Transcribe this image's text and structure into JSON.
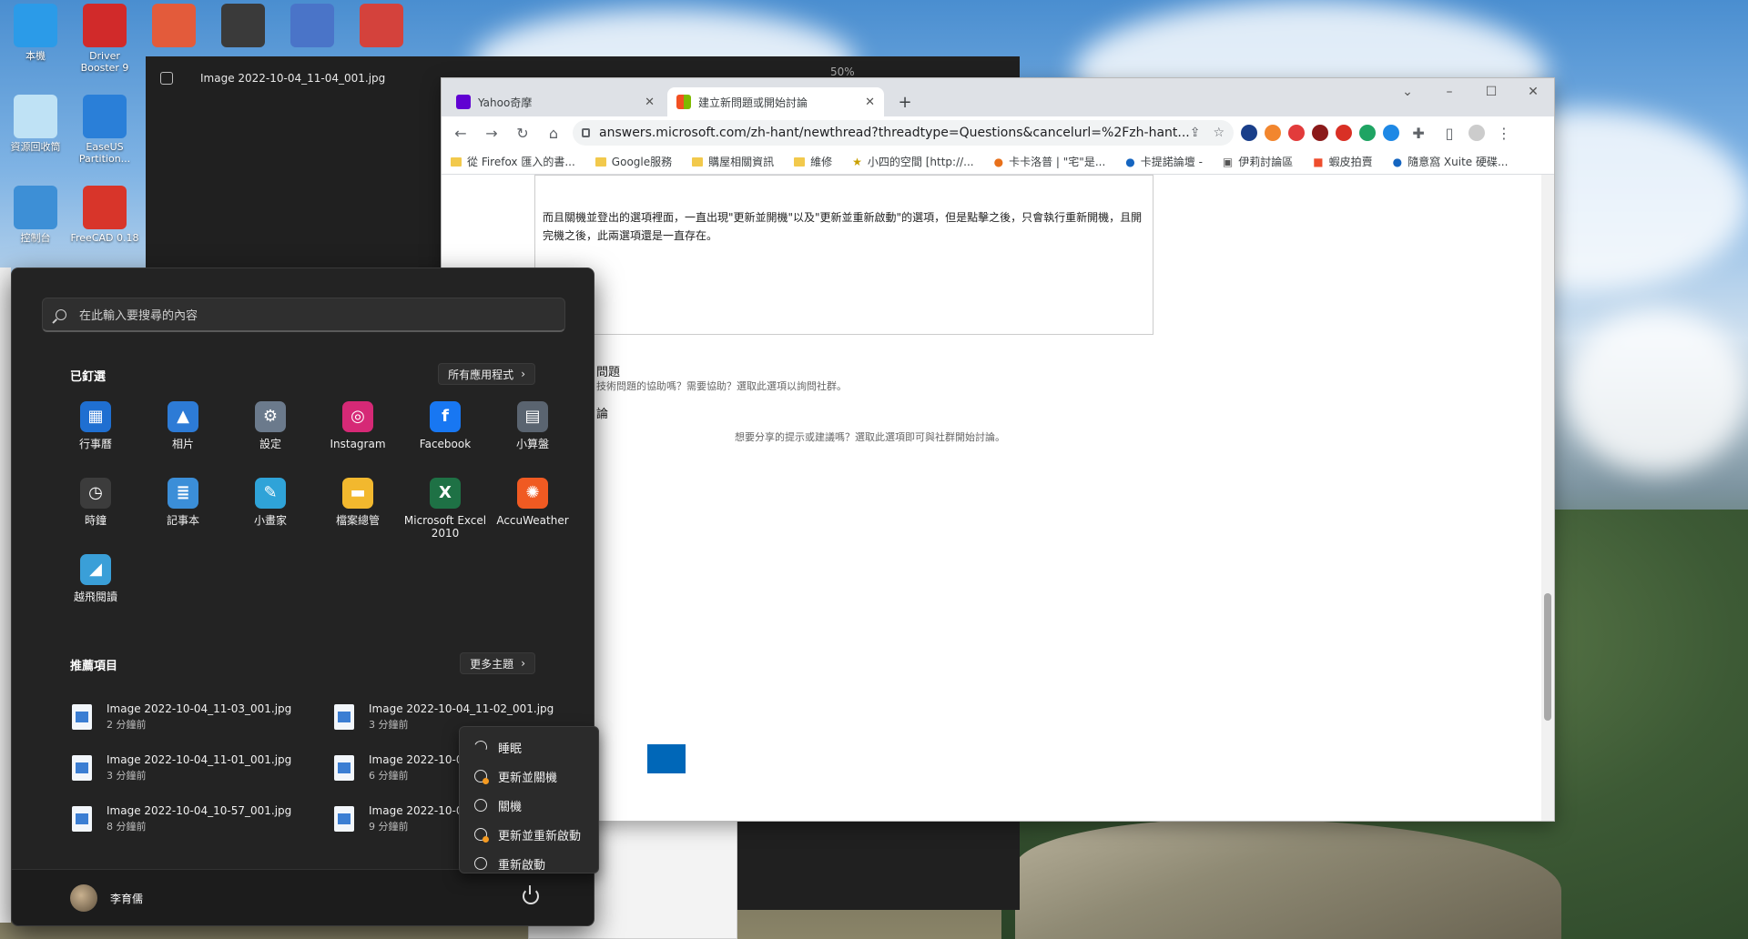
{
  "desktop": {
    "icons": [
      {
        "label": "本機",
        "color": "#2b9be8"
      },
      {
        "label": "Driver Booster 9",
        "color": "#d12a2a"
      },
      {
        "label": "",
        "color": "#e35b3b"
      },
      {
        "label": "",
        "color": "#3a3a3a"
      },
      {
        "label": "",
        "color": "#4a74c8"
      },
      {
        "label": "",
        "color": "#d4423c"
      },
      {
        "label": "資源回收筒",
        "color": "#bfe2f5"
      },
      {
        "label": "EaseUS Partition...",
        "color": "#2a7fd8"
      },
      {
        "label": "控制台",
        "color": "#3d8fd6"
      },
      {
        "label": "FreeCAD 0.18",
        "color": "#d8352a"
      }
    ]
  },
  "viewer": {
    "title": "Image 2022-10-04_11-04_001.jpg",
    "zoom": "50%"
  },
  "chrome": {
    "tabs": [
      {
        "title": "Yahoo奇摩",
        "favicon_color": "#6001d2"
      },
      {
        "title": "建立新問題或開始討論",
        "favicon_color": "#f25022"
      }
    ],
    "new_tab": "+",
    "url": "answers.microsoft.com/zh-hant/newthread?threadtype=Questions&cancelurl=%2Fzh-hant...",
    "bookmarks": [
      "從 Firefox 匯入的書...",
      "Google服務",
      "購屋相關資訊",
      "維修",
      "小四的空間 [http://...",
      "卡卡洛普 | \"宅\"是...",
      "卡提諾論壇 -",
      "伊莉討論區",
      "蝦皮拍賣",
      "隨意窩 Xuite 硬碟..."
    ],
    "body_text": "而且關機並登出的選項裡面，一直出現\"更新並開機\"以及\"更新並重新啟動\"的選項，但是點擊之後，只會執行重新開機，且開完機之後，此兩選項還是一直存在。",
    "option1_title": "問題",
    "option1_desc": "技術問題的協助嗎？需要協助？選取此選項以詢問社群。",
    "option2_title": "論",
    "option2_desc": "想要分享的提示或建議嗎？選取此選項即可與社群開始討論。"
  },
  "start_menu": {
    "search_placeholder": "在此輸入要搜尋的內容",
    "pinned_title": "已釘選",
    "all_apps_label": "所有應用程式",
    "pinned_apps": [
      {
        "label": "行事曆",
        "color": "#1f6fd1",
        "glyph": "▦"
      },
      {
        "label": "相片",
        "color": "#2d7bd6",
        "glyph": "▲"
      },
      {
        "label": "設定",
        "color": "#6b7a8c",
        "glyph": "⚙"
      },
      {
        "label": "Instagram",
        "color": "#d62976",
        "glyph": "◎"
      },
      {
        "label": "Facebook",
        "color": "#1877f2",
        "glyph": "f"
      },
      {
        "label": "小算盤",
        "color": "#5a6470",
        "glyph": "▤"
      },
      {
        "label": "時鐘",
        "color": "#3c3c3c",
        "glyph": "◷"
      },
      {
        "label": "記事本",
        "color": "#3b8ed8",
        "glyph": "≣"
      },
      {
        "label": "小畫家",
        "color": "#2fa3d8",
        "glyph": "✎"
      },
      {
        "label": "檔案總管",
        "color": "#f2b82e",
        "glyph": "▬"
      },
      {
        "label": "Microsoft Excel 2010",
        "color": "#1e7145",
        "glyph": "X"
      },
      {
        "label": "AccuWeather",
        "color": "#f05a22",
        "glyph": "✺"
      },
      {
        "label": "越飛閱讀",
        "color": "#3a9fd8",
        "glyph": "◢"
      }
    ],
    "recommended_title": "推薦項目",
    "more_label": "更多主題",
    "recommended": [
      {
        "name": "Image 2022-10-04_11-03_001.jpg",
        "time": "2 分鐘前"
      },
      {
        "name": "Image 2022-10-04_11-02_001.jpg",
        "time": "3 分鐘前"
      },
      {
        "name": "Image 2022-10-04_11-01_001.jpg",
        "time": "3 分鐘前"
      },
      {
        "name": "Image 2022-10-04",
        "time": "6 分鐘前"
      },
      {
        "name": "Image 2022-10-04_10-57_001.jpg",
        "time": "8 分鐘前"
      },
      {
        "name": "Image 2022-10-04",
        "time": "9 分鐘前"
      }
    ],
    "user_name": "李育儒"
  },
  "power_menu": {
    "items": [
      "睡眠",
      "更新並關機",
      "關機",
      "更新並重新啟動",
      "重新啟動"
    ]
  }
}
